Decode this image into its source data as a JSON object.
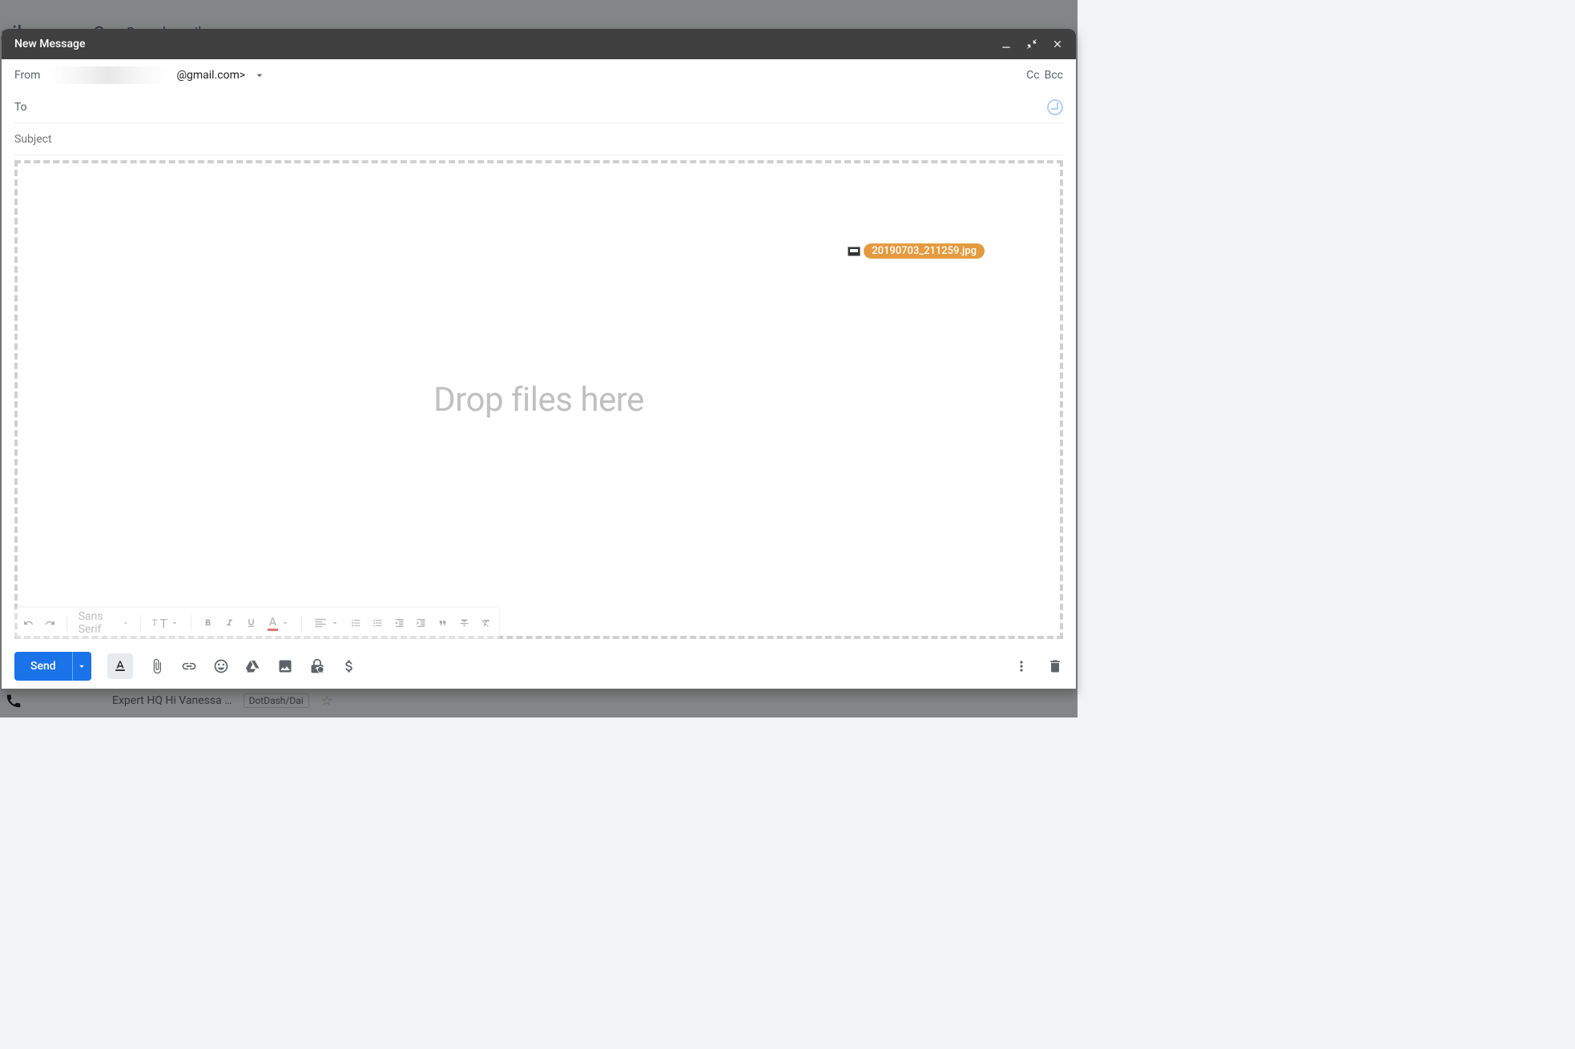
{
  "background": {
    "logo_text": "ail",
    "search_placeholder": "Search mail",
    "inbox_row_preview": "Expert HQ Hi Vanessa …",
    "inbox_row_tag": "DotDash/Dai"
  },
  "compose": {
    "title": "New Message",
    "from_label": "From",
    "from_domain_suffix": "@gmail.com>",
    "cc_label": "Cc",
    "bcc_label": "Bcc",
    "to_label": "To",
    "subject_placeholder": "Subject",
    "dropzone_text": "Drop files here",
    "drag_file_name": "20190703_211259.jpg",
    "format_font": "Sans Serif",
    "send_label": "Send"
  }
}
